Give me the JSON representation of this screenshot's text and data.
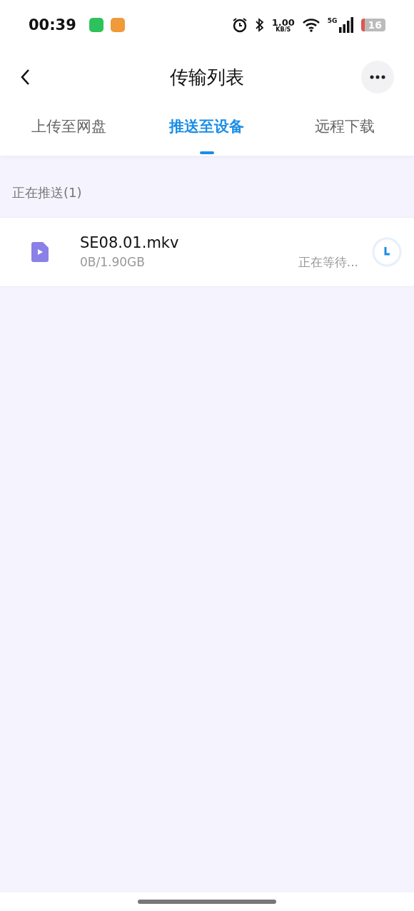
{
  "status_bar": {
    "time": "00:39",
    "speed": "1.00",
    "speed_unit": "KB/S",
    "network": "5G",
    "battery": "16"
  },
  "header": {
    "title": "传输列表"
  },
  "tabs": [
    {
      "label": "上传至网盘",
      "selected": false
    },
    {
      "label": "推送至设备",
      "selected": true
    },
    {
      "label": "远程下载",
      "selected": false
    }
  ],
  "section": {
    "title": "正在推送(1)"
  },
  "transfers": [
    {
      "name": "SE08.01.mkv",
      "size": "0B/1.90GB",
      "status": "正在等待..."
    }
  ]
}
